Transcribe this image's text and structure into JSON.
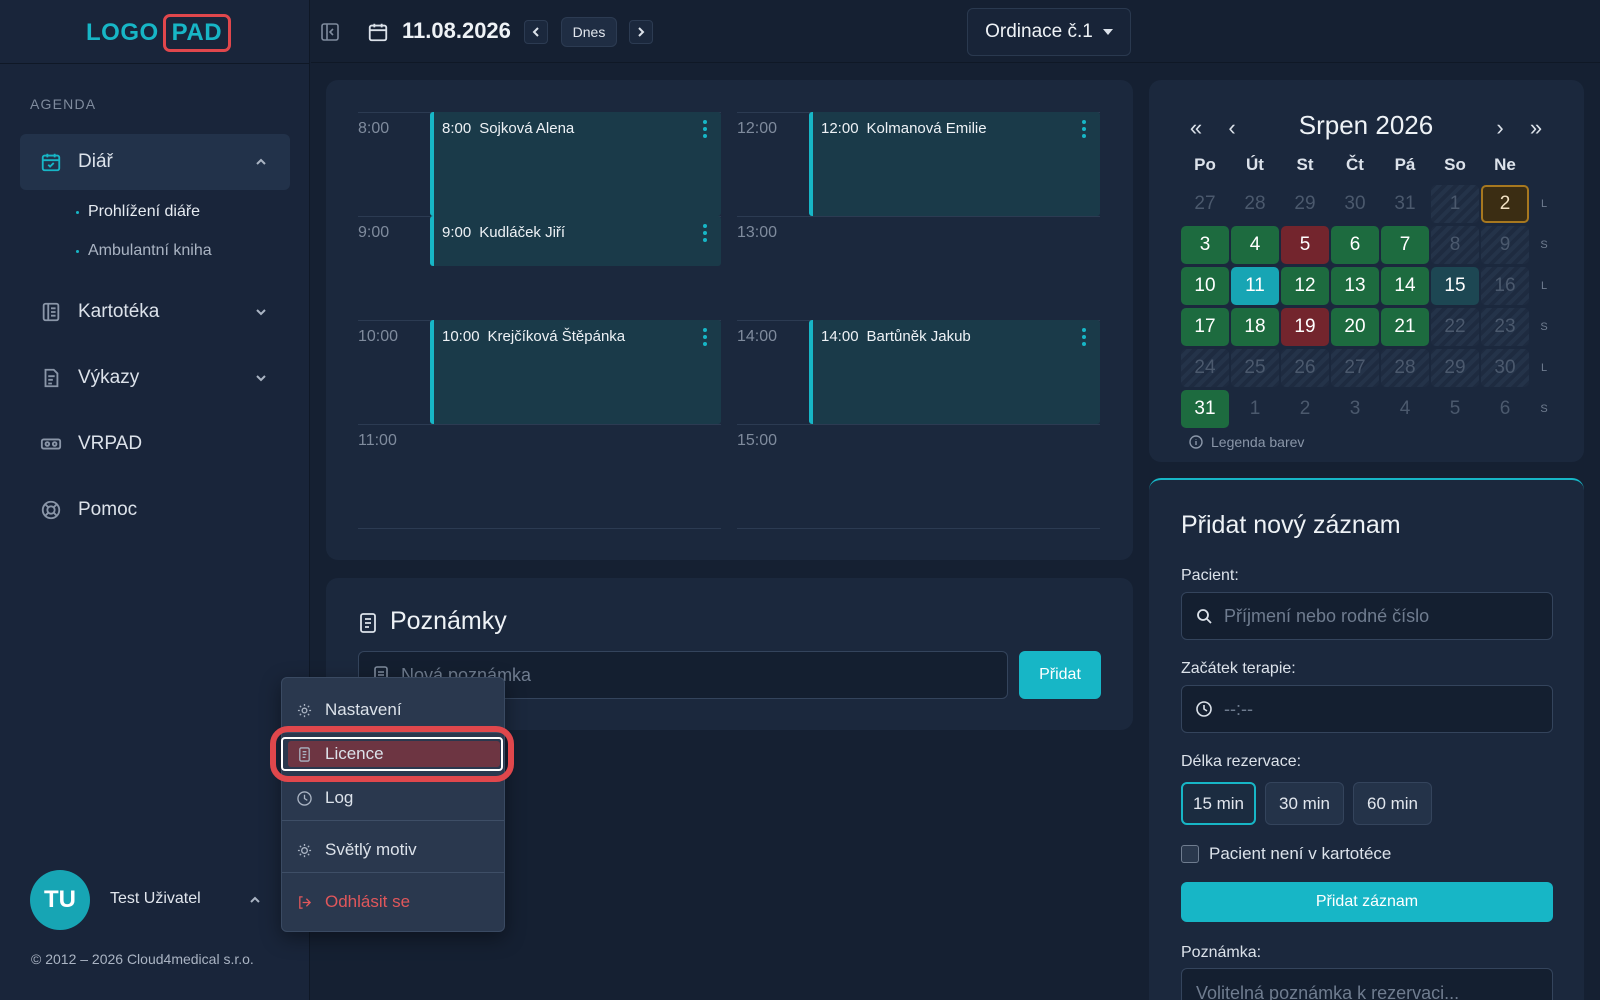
{
  "logo": {
    "part1": "LOGO",
    "part2": "PAD"
  },
  "sidebar": {
    "section_label": "AGENDA",
    "items": [
      {
        "label": "Diář",
        "icon": "calendar-check-icon"
      },
      {
        "label": "Kartotéka",
        "icon": "book-icon"
      },
      {
        "label": "Výkazy",
        "icon": "report-icon"
      },
      {
        "label": "VRPAD",
        "icon": "vr-headset-icon"
      },
      {
        "label": "Pomoc",
        "icon": "lifebuoy-icon"
      }
    ],
    "sub_items": [
      {
        "label": "Prohlížení diáře"
      },
      {
        "label": "Ambulantní kniha"
      }
    ]
  },
  "user": {
    "initials": "TU",
    "name": "Test Uživatel"
  },
  "copyright": "© 2012 – 2026 Cloud4medical s.r.o.",
  "topbar": {
    "date": "11.08.2026",
    "today_label": "Dnes",
    "office": "Ordinace č.1"
  },
  "schedule": {
    "left_times": [
      "8:00",
      "9:00",
      "10:00",
      "11:00"
    ],
    "right_times": [
      "12:00",
      "13:00",
      "14:00",
      "15:00"
    ],
    "appointments": [
      {
        "time": "8:00",
        "name": "Sojková Alena"
      },
      {
        "time": "9:00",
        "name": "Kudláček Jiří"
      },
      {
        "time": "10:00",
        "name": "Krejčíková Štěpánka"
      },
      {
        "time": "12:00",
        "name": "Kolmanová Emilie"
      },
      {
        "time": "14:00",
        "name": "Bartůněk Jakub"
      }
    ]
  },
  "notes": {
    "title": "Poznámky",
    "placeholder": "Nová poznámka",
    "add_label": "Přidat"
  },
  "calendar": {
    "month_label": "Srpen 2026",
    "nav": {
      "first": "«",
      "prev": "‹",
      "next": "›",
      "last": "»"
    },
    "weekdays": [
      "Po",
      "Út",
      "St",
      "Čt",
      "Pá",
      "So",
      "Ne"
    ],
    "weeks": [
      {
        "days": [
          "27",
          "28",
          "29",
          "30",
          "31",
          "1",
          "2"
        ],
        "marker": "L"
      },
      {
        "days": [
          "3",
          "4",
          "5",
          "6",
          "7",
          "8",
          "9"
        ],
        "marker": "S"
      },
      {
        "days": [
          "10",
          "11",
          "12",
          "13",
          "14",
          "15",
          "16"
        ],
        "marker": "L"
      },
      {
        "days": [
          "17",
          "18",
          "19",
          "20",
          "21",
          "22",
          "23"
        ],
        "marker": "S"
      },
      {
        "days": [
          "24",
          "25",
          "26",
          "27",
          "28",
          "29",
          "30"
        ],
        "marker": "L"
      },
      {
        "days": [
          "31",
          "1",
          "2",
          "3",
          "4",
          "5",
          "6"
        ],
        "marker": "S"
      }
    ],
    "legend_label": "Legenda barev",
    "colors": {
      "available": "#1d6b3f",
      "full": "#73252d",
      "selected": "#17a5b4",
      "today": "#a7781f"
    }
  },
  "new_entry": {
    "title": "Přidat nový záznam",
    "patient_label": "Pacient:",
    "patient_placeholder": "Příjmení nebo rodné číslo",
    "start_label": "Začátek terapie:",
    "start_placeholder": "--:--",
    "duration_label": "Délka rezervace:",
    "durations": [
      "15 min",
      "30 min",
      "60 min"
    ],
    "not_in_file_label": "Pacient není v kartotéce",
    "add_label": "Přidat záznam",
    "note_label": "Poznámka:",
    "note_placeholder": "Volitelná poznámka k rezervaci..."
  },
  "user_menu": {
    "items": [
      {
        "label": "Nastavení",
        "icon": "gear-icon"
      },
      {
        "label": "Licence",
        "icon": "document-icon"
      },
      {
        "label": "Log",
        "icon": "clock-icon"
      },
      {
        "label": "Světlý motiv",
        "icon": "sun-icon"
      },
      {
        "label": "Odhlásit se",
        "icon": "logout-icon"
      }
    ]
  },
  "accent_color": "#17b6c6"
}
